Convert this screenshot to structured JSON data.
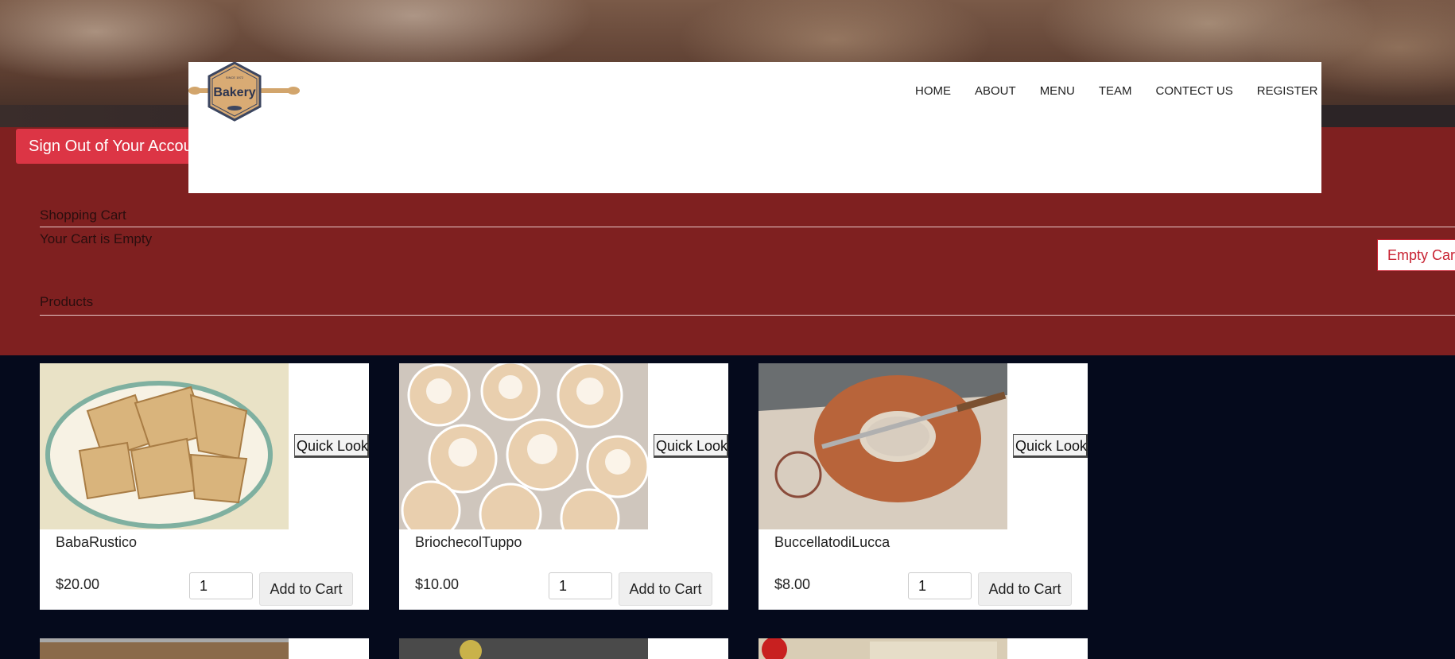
{
  "header": {
    "logo_text": "Bakery",
    "logo_tagline": "SINCE 1972",
    "nav": [
      "HOME",
      "ABOUT",
      "MENU",
      "TEAM",
      "CONTECT US",
      "REGISTER"
    ]
  },
  "account": {
    "signout_label": "Sign Out of Your Account"
  },
  "cart": {
    "title": "Shopping Cart",
    "status": "Your Cart is Empty",
    "empty_label": "Empty Cart"
  },
  "products": {
    "title": "Products",
    "quick_look_label": "Quick Look",
    "add_label": "Add to Cart",
    "items": [
      {
        "name": "BabaRustico",
        "price": "$20.00",
        "qty": "1"
      },
      {
        "name": "BriochecolTuppo",
        "price": "$10.00",
        "qty": "1"
      },
      {
        "name": "BuccellatodiLucca",
        "price": "$8.00",
        "qty": "1"
      }
    ]
  },
  "colors": {
    "panel": "#7f2020",
    "page_bg": "#050a1c",
    "danger": "#dc3545"
  }
}
